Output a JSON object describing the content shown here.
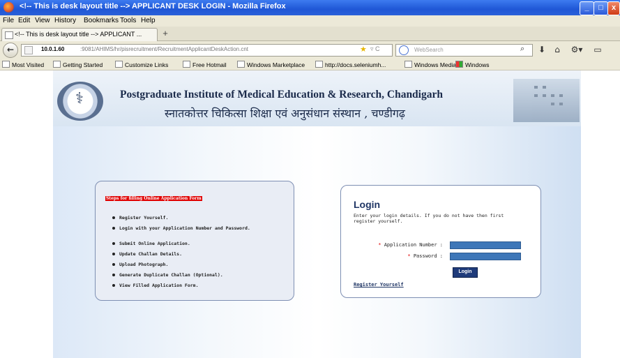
{
  "window": {
    "title": "<!-- This is desk layout title --> APPLICANT DESK LOGIN - Mozilla Firefox",
    "minimize": "_",
    "maximize": "□",
    "close": "x"
  },
  "menu": [
    "File",
    "Edit",
    "View",
    "History",
    "Bookmarks",
    "Tools",
    "Help"
  ],
  "tab": {
    "label": "<!-- This is desk layout title --> APPLICANT ...",
    "new_tab": "+"
  },
  "nav": {
    "url_host": "10.0.1.60",
    "url_path": ":9081/AHIMS/hr/pisrecruitment/RecruitmentApplicantDeskAction.cnt",
    "search_placeholder": "WebSearch"
  },
  "bookmarks": [
    "Most Visited",
    "Getting Started",
    "Customize Links",
    "Free Hotmail",
    "Windows Marketplace",
    "http://docs.seleniumh...",
    "Windows Media",
    "Windows"
  ],
  "header": {
    "institute_en": "Postgraduate Institute of Medical Education & Research, Chandigarh",
    "institute_hi": "स्नातकोत्तर चिकित्सा शिक्षा एवं अनुसंधान संस्थान , चण्डीगढ़"
  },
  "steps": {
    "title": "Steps for filling Online Application Form",
    "items": [
      "Register Yourself.",
      "Login with your Application Number and Password.",
      "Submit Online Application.",
      "Update Challan Details.",
      "Upload Photograph.",
      "Generate Duplicate Challan (Optional).",
      "View Filled Application Form."
    ]
  },
  "login": {
    "title": "Login",
    "description": "Enter your login details. If you do not have then first register yourself.",
    "app_number_label": "Application Number :",
    "password_label": "Password :",
    "required_mark": "*",
    "button": "Login",
    "register_link": "Register Yourself"
  }
}
